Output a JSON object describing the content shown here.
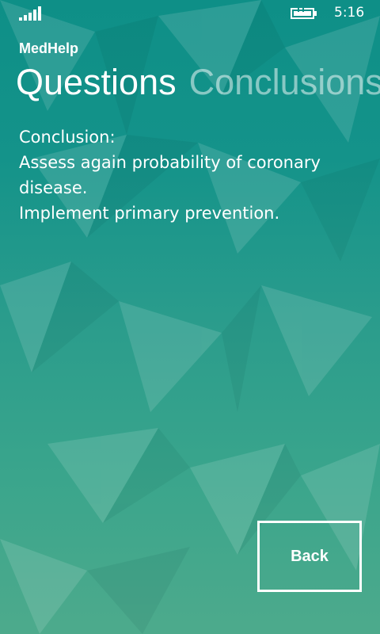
{
  "status_bar": {
    "signal_icon": "cellular-signal-icon",
    "battery_icon": "battery-charging-icon",
    "time": "5:16"
  },
  "app": {
    "title": "MedHelp"
  },
  "pivot": {
    "items": [
      {
        "label": "Questions",
        "active": true
      },
      {
        "label": "Conclusions",
        "active": false
      }
    ]
  },
  "content": {
    "heading": "Conclusion:",
    "line1": "Assess again probability of coronary disease.",
    "line2": "Implement primary prevention."
  },
  "actions": {
    "back_label": "Back"
  },
  "colors": {
    "background_top": "#0e8f87",
    "background_bottom": "#4daa8c",
    "text": "#ffffff",
    "inactive_text": "#9fd0c8"
  }
}
